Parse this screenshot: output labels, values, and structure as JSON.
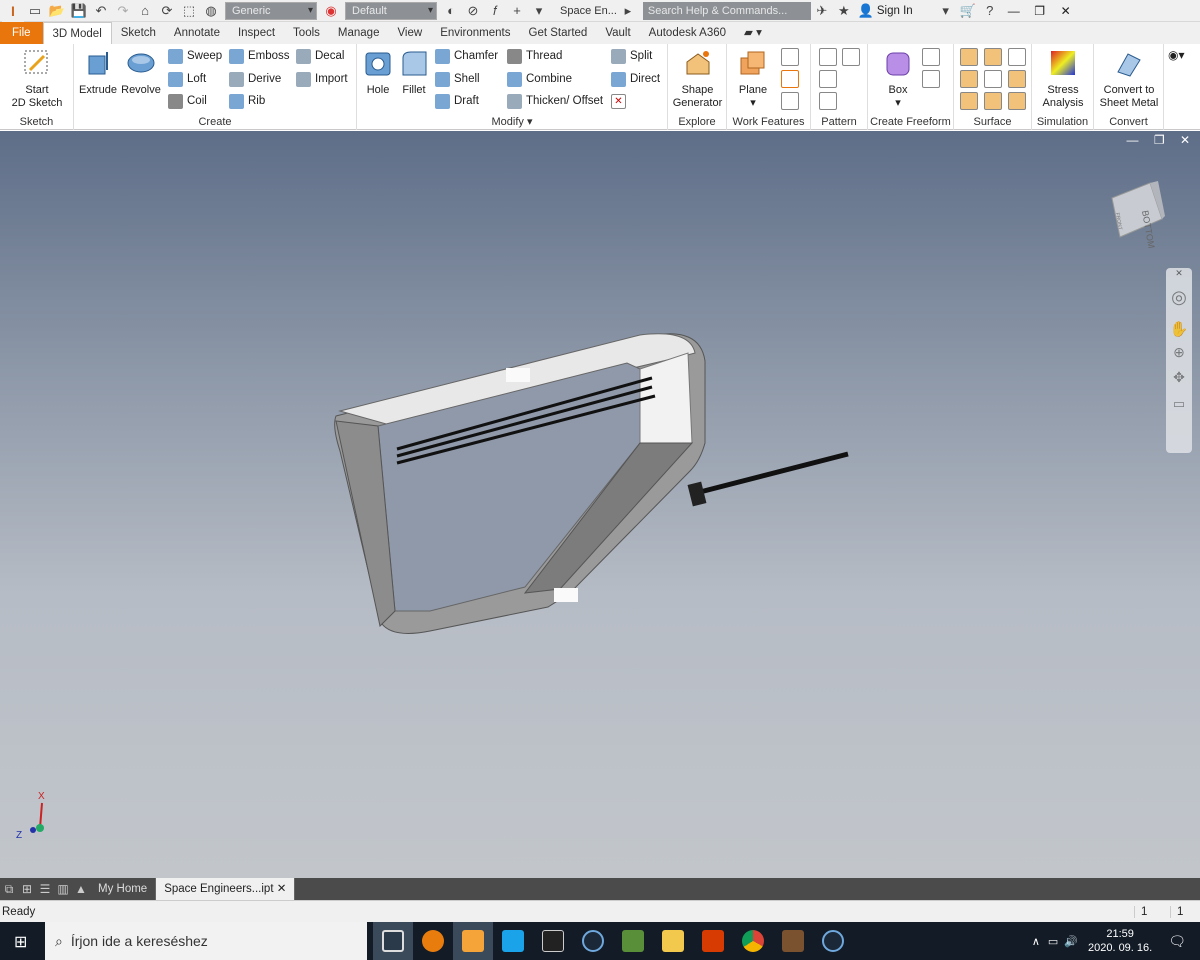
{
  "app": {
    "title": "Space En...",
    "logo": "I",
    "logo_sub": "PRO"
  },
  "qat": {
    "material": "Generic",
    "appearance": "Default",
    "search_placeholder": "Search Help & Commands...",
    "sign_in": "Sign In"
  },
  "tabs": [
    {
      "label": "File"
    },
    {
      "label": "3D Model"
    },
    {
      "label": "Sketch"
    },
    {
      "label": "Annotate"
    },
    {
      "label": "Inspect"
    },
    {
      "label": "Tools"
    },
    {
      "label": "Manage"
    },
    {
      "label": "View"
    },
    {
      "label": "Environments"
    },
    {
      "label": "Get Started"
    },
    {
      "label": "Vault"
    },
    {
      "label": "Autodesk A360"
    }
  ],
  "active_tab": "3D Model",
  "ribbon": {
    "sketch": {
      "title": "Sketch",
      "start_label": "Start",
      "start_label2": "2D Sketch"
    },
    "create": {
      "title": "Create",
      "extrude": "Extrude",
      "revolve": "Revolve",
      "sweep": "Sweep",
      "loft": "Loft",
      "coil": "Coil",
      "emboss": "Emboss",
      "derive": "Derive",
      "rib": "Rib",
      "decal": "Decal",
      "import": "Import"
    },
    "modify": {
      "title": "Modify ▾",
      "hole": "Hole",
      "fillet": "Fillet",
      "chamfer": "Chamfer",
      "shell": "Shell",
      "draft": "Draft",
      "thread": "Thread",
      "combine": "Combine",
      "thicken": "Thicken/ Offset",
      "split": "Split",
      "direct": "Direct"
    },
    "explore": {
      "title": "Explore",
      "shape1": "Shape",
      "shape2": "Generator"
    },
    "work": {
      "title": "Work Features",
      "plane": "Plane"
    },
    "pattern": {
      "title": "Pattern"
    },
    "freeform": {
      "title": "Create Freeform",
      "box": "Box"
    },
    "surface": {
      "title": "Surface"
    },
    "simulation": {
      "title": "Simulation",
      "stress1": "Stress",
      "stress2": "Analysis"
    },
    "convert": {
      "title": "Convert",
      "c1": "Convert to",
      "c2": "Sheet Metal"
    }
  },
  "viewcube": {
    "face": "BOTTOM",
    "side": "FRONT"
  },
  "axes": {
    "x": "X",
    "z": "Z"
  },
  "doc_tabs": [
    {
      "label": "My Home"
    },
    {
      "label": "Space Engineers...ipt"
    }
  ],
  "status": {
    "text": "Ready",
    "count1": "1",
    "count2": "1"
  },
  "taskbar": {
    "search_placeholder": "Írjon ide a kereséshez",
    "time": "21:59",
    "date": "2020. 09. 16."
  },
  "colors": {
    "file_tab": "#e8760d",
    "taskbar": "#121b26"
  }
}
